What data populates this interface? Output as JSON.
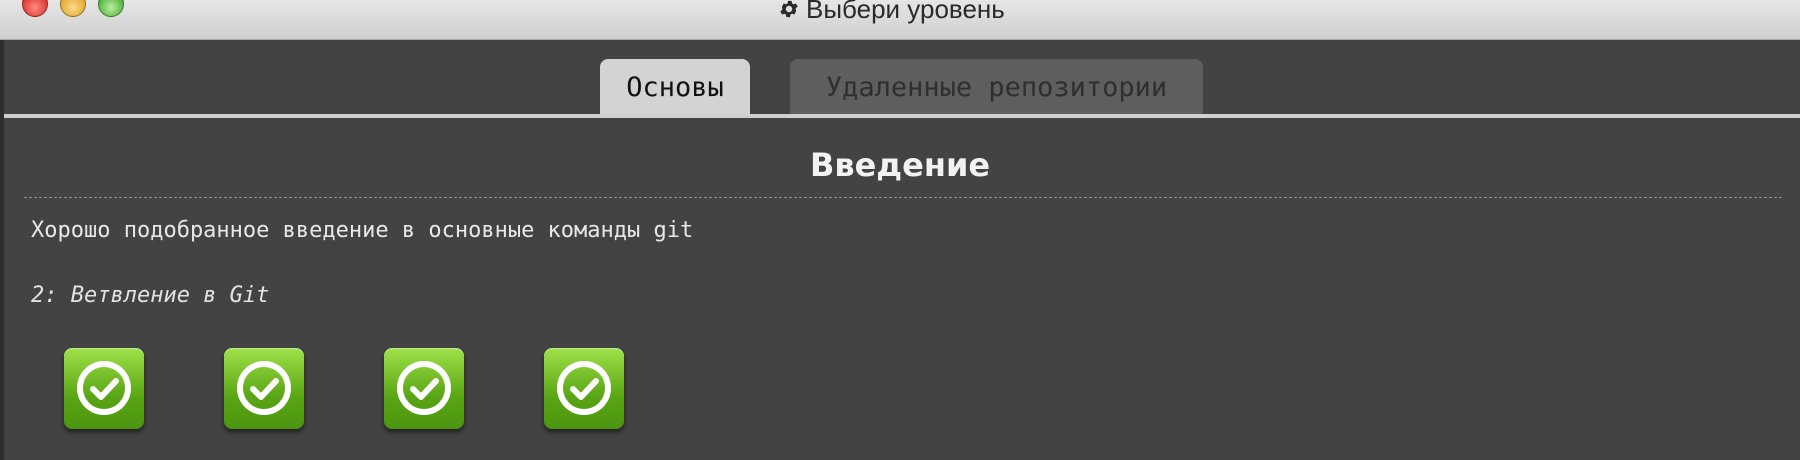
{
  "window": {
    "title": "Выбери уровень",
    "title_icon": "gear-icon"
  },
  "tabs": [
    {
      "label": "Основы",
      "selected": true
    },
    {
      "label": "Удаленные репозитории",
      "selected": false
    }
  ],
  "section": {
    "title": "Введение",
    "description": "Хорошо подобранное введение в основные команды git",
    "current_level": "2: Ветвление в Git"
  },
  "levels": [
    {
      "icon": "check-circle-icon",
      "status": "completed"
    },
    {
      "icon": "check-circle-icon",
      "status": "completed"
    },
    {
      "icon": "check-circle-icon",
      "status": "completed"
    },
    {
      "icon": "check-circle-icon",
      "status": "completed"
    }
  ],
  "colors": {
    "background": "#434343",
    "active_tab": "#d3d3d3",
    "inactive_tab": "#5e5e5e",
    "level_complete": "#6cbf1f"
  }
}
